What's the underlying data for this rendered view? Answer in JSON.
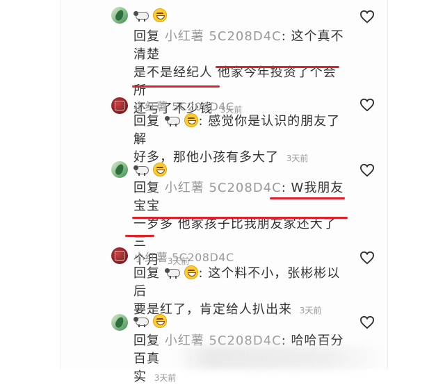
{
  "reply_label": "回复",
  "comments": [
    {
      "author": "",
      "reply_to": "小红薯 5C208D4C",
      "text_lines": [
        "这个真不清楚",
        "是不是经纪人 他家今年投资了个会所",
        "还亏了不少钱"
      ],
      "time": "3天前"
    },
    {
      "author": "小红薯 5C208D4C",
      "text_lines": [
        "感觉你是认识的朋友了解",
        "好多，那他小孩有多大了"
      ],
      "time": "3天前"
    },
    {
      "reply_to": "小红薯 5C208D4C",
      "text_lines": [
        "W我朋友宝宝",
        "一岁多 他家孩子比我朋友家还大了三",
        "个月"
      ],
      "time": "3天前"
    },
    {
      "author": "小红薯 5C208D4C",
      "text_lines": [
        "这个料不小，张彬彬以后",
        "要是红了，肯定给人扒出来"
      ],
      "time": "3天前"
    },
    {
      "reply_to": "小红薯 5C208D4C",
      "text_lines": [
        "哈哈百分百真",
        "实"
      ],
      "time": "3天前"
    }
  ],
  "annotation_color": "#e0212a"
}
